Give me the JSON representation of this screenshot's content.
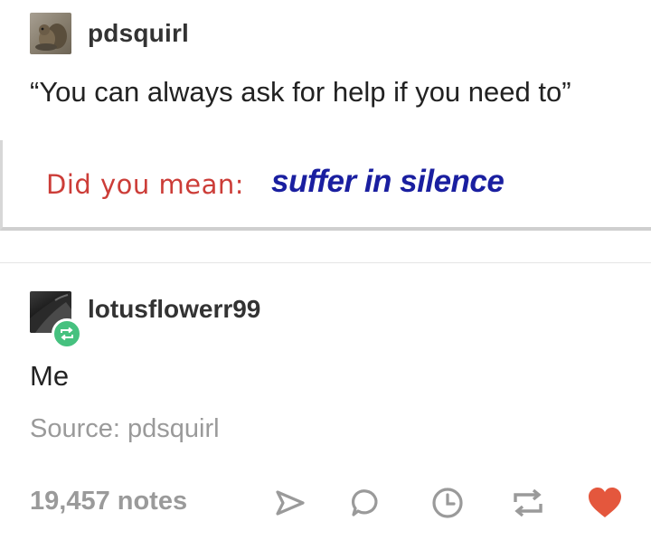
{
  "post": {
    "username": "pdsquirl",
    "text": "“You can always ask for help if you need to”",
    "embedded_image": {
      "prefix": "Did you mean:",
      "suggestion": "suffer in silence"
    }
  },
  "reblog": {
    "username": "lotusflowerr99",
    "text": "Me",
    "source": "Source: pdsquirl"
  },
  "footer": {
    "notes": "19,457 notes",
    "icons": [
      "share-icon",
      "reply-icon",
      "clock-icon",
      "reblog-icon",
      "heart-icon"
    ]
  },
  "colors": {
    "did_you_mean": "#cc3d38",
    "suggestion": "#1a1fa0",
    "reblog_badge": "#46c17f",
    "heart": "#e4573d",
    "icon_gray": "#9a9a9a"
  }
}
